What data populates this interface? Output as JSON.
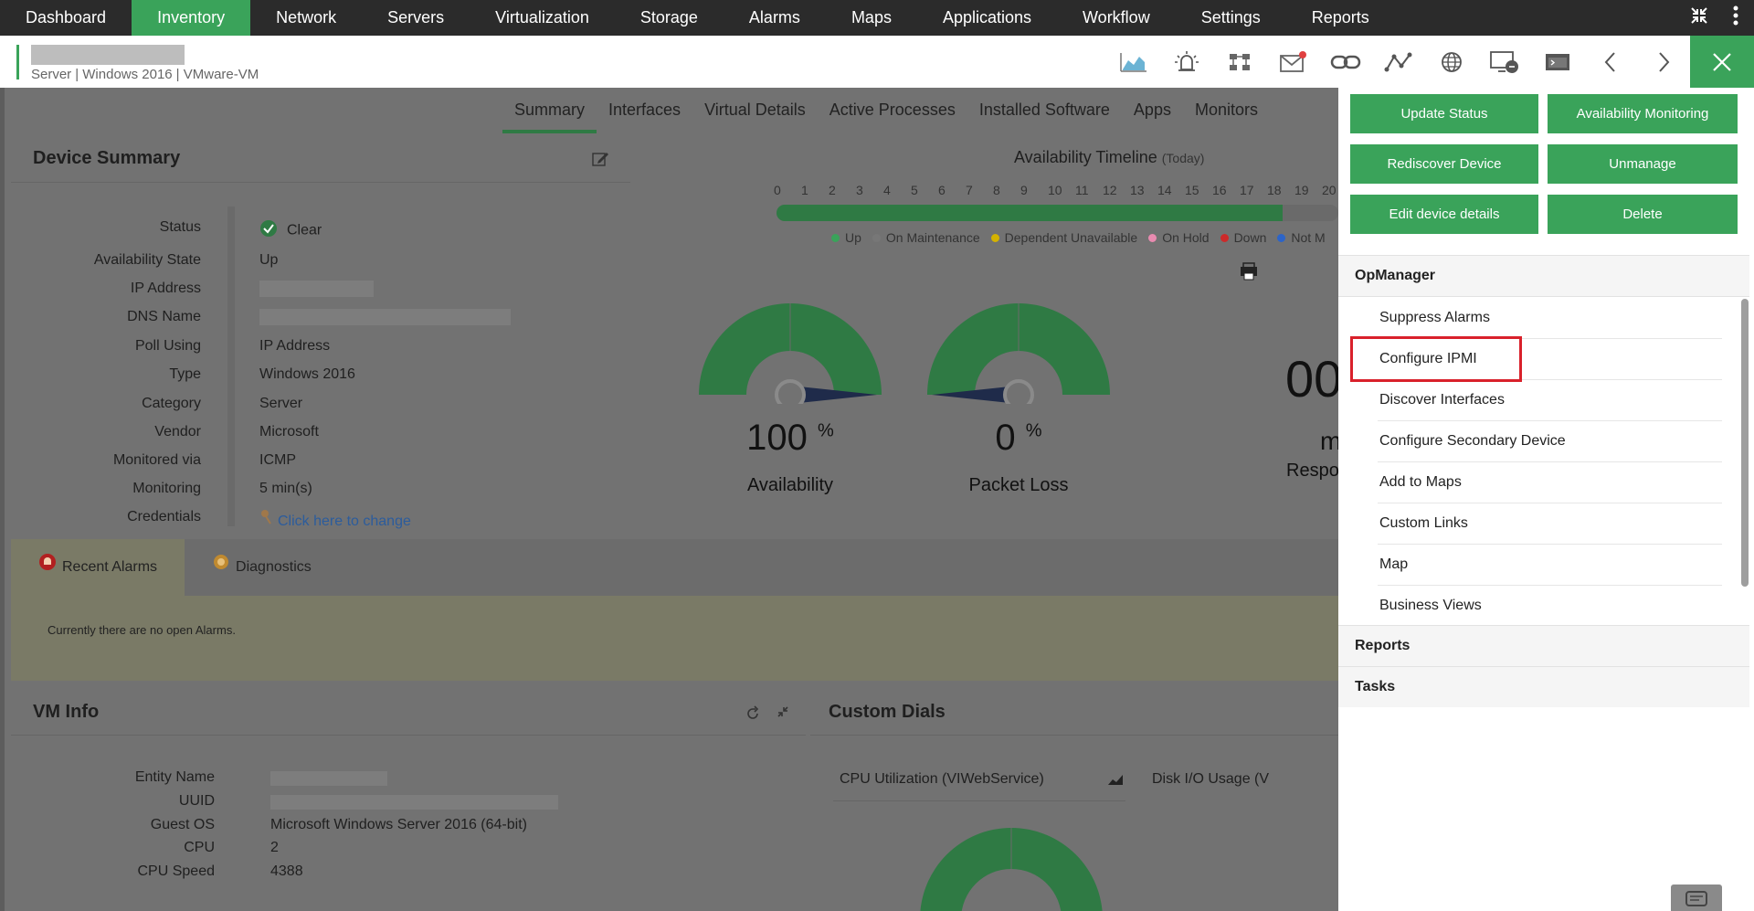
{
  "nav": {
    "items": [
      "Dashboard",
      "Inventory",
      "Network",
      "Servers",
      "Virtualization",
      "Storage",
      "Alarms",
      "Maps",
      "Applications",
      "Workflow",
      "Settings",
      "Reports"
    ],
    "active": "Inventory"
  },
  "device": {
    "subtitle_parts": [
      "Server",
      "Windows 2016",
      "VMware-VM"
    ]
  },
  "tabs": [
    "Summary",
    "Interfaces",
    "Virtual Details",
    "Active Processes",
    "Installed Software",
    "Apps",
    "Monitors"
  ],
  "device_summary": {
    "title": "Device Summary",
    "rows": [
      {
        "label": "Status",
        "value": "Clear"
      },
      {
        "label": "Availability State",
        "value": "Up"
      },
      {
        "label": "IP Address",
        "value": ""
      },
      {
        "label": "DNS Name",
        "value": ""
      },
      {
        "label": "Poll Using",
        "value": "IP Address"
      },
      {
        "label": "Type",
        "value": "Windows 2016"
      },
      {
        "label": "Category",
        "value": "Server"
      },
      {
        "label": "Vendor",
        "value": "Microsoft"
      },
      {
        "label": "Monitored via",
        "value": "ICMP"
      },
      {
        "label": "Monitoring",
        "value": "5 min(s)"
      },
      {
        "label": "Credentials",
        "value": "Click here to change"
      }
    ]
  },
  "availability": {
    "title": "Availability Timeline",
    "title_suffix": "(Today)",
    "hours": [
      "0",
      "1",
      "2",
      "3",
      "4",
      "5",
      "6",
      "7",
      "8",
      "9",
      "10",
      "11",
      "12",
      "13",
      "14",
      "15",
      "16",
      "17",
      "18",
      "19",
      "20"
    ],
    "legend": [
      "Up",
      "On Maintenance",
      "Dependent Unavailable",
      "On Hold",
      "Down",
      "Not M"
    ],
    "legend_colors": [
      "#3aa35a",
      "#777777",
      "#d4b200",
      "#e98bb0",
      "#cc2a2a",
      "#2c64c8"
    ],
    "up_fraction": 0.9,
    "gauges": [
      {
        "value": "100",
        "unit": "%",
        "label": "Availability",
        "fill": 1.0
      },
      {
        "value": "0",
        "unit": "%",
        "label": "Packet Loss",
        "fill": 0.0
      }
    ],
    "third_gauge_value": "00",
    "third_gauge_label": "Respon",
    "third_gauge_unit": "m"
  },
  "alarms": {
    "tabs": [
      "Recent Alarms",
      "Diagnostics"
    ],
    "message": "Currently there are no open Alarms."
  },
  "vm_info": {
    "title": "VM Info",
    "rows": [
      {
        "label": "Entity Name",
        "value": ""
      },
      {
        "label": "UUID",
        "value": ""
      },
      {
        "label": "Guest OS",
        "value": "Microsoft Windows Server 2016 (64-bit)"
      },
      {
        "label": "CPU",
        "value": "2"
      },
      {
        "label": "CPU Speed",
        "value": "4388"
      }
    ]
  },
  "custom_dials": {
    "title": "Custom Dials",
    "dial1": "CPU Utilization (VIWebService)",
    "dial2": "Disk I/O Usage (V"
  },
  "menu": {
    "buttons": [
      "Update Status",
      "Availability Monitoring",
      "Rediscover Device",
      "Unmanage",
      "Edit device details",
      "Delete"
    ],
    "section_opmanager": "OpManager",
    "opmanager_items": [
      "Suppress Alarms",
      "Configure IPMI",
      "Discover Interfaces",
      "Configure Secondary Device",
      "Add to Maps",
      "Custom Links",
      "Map",
      "Business Views"
    ],
    "section_reports": "Reports",
    "section_tasks": "Tasks"
  }
}
